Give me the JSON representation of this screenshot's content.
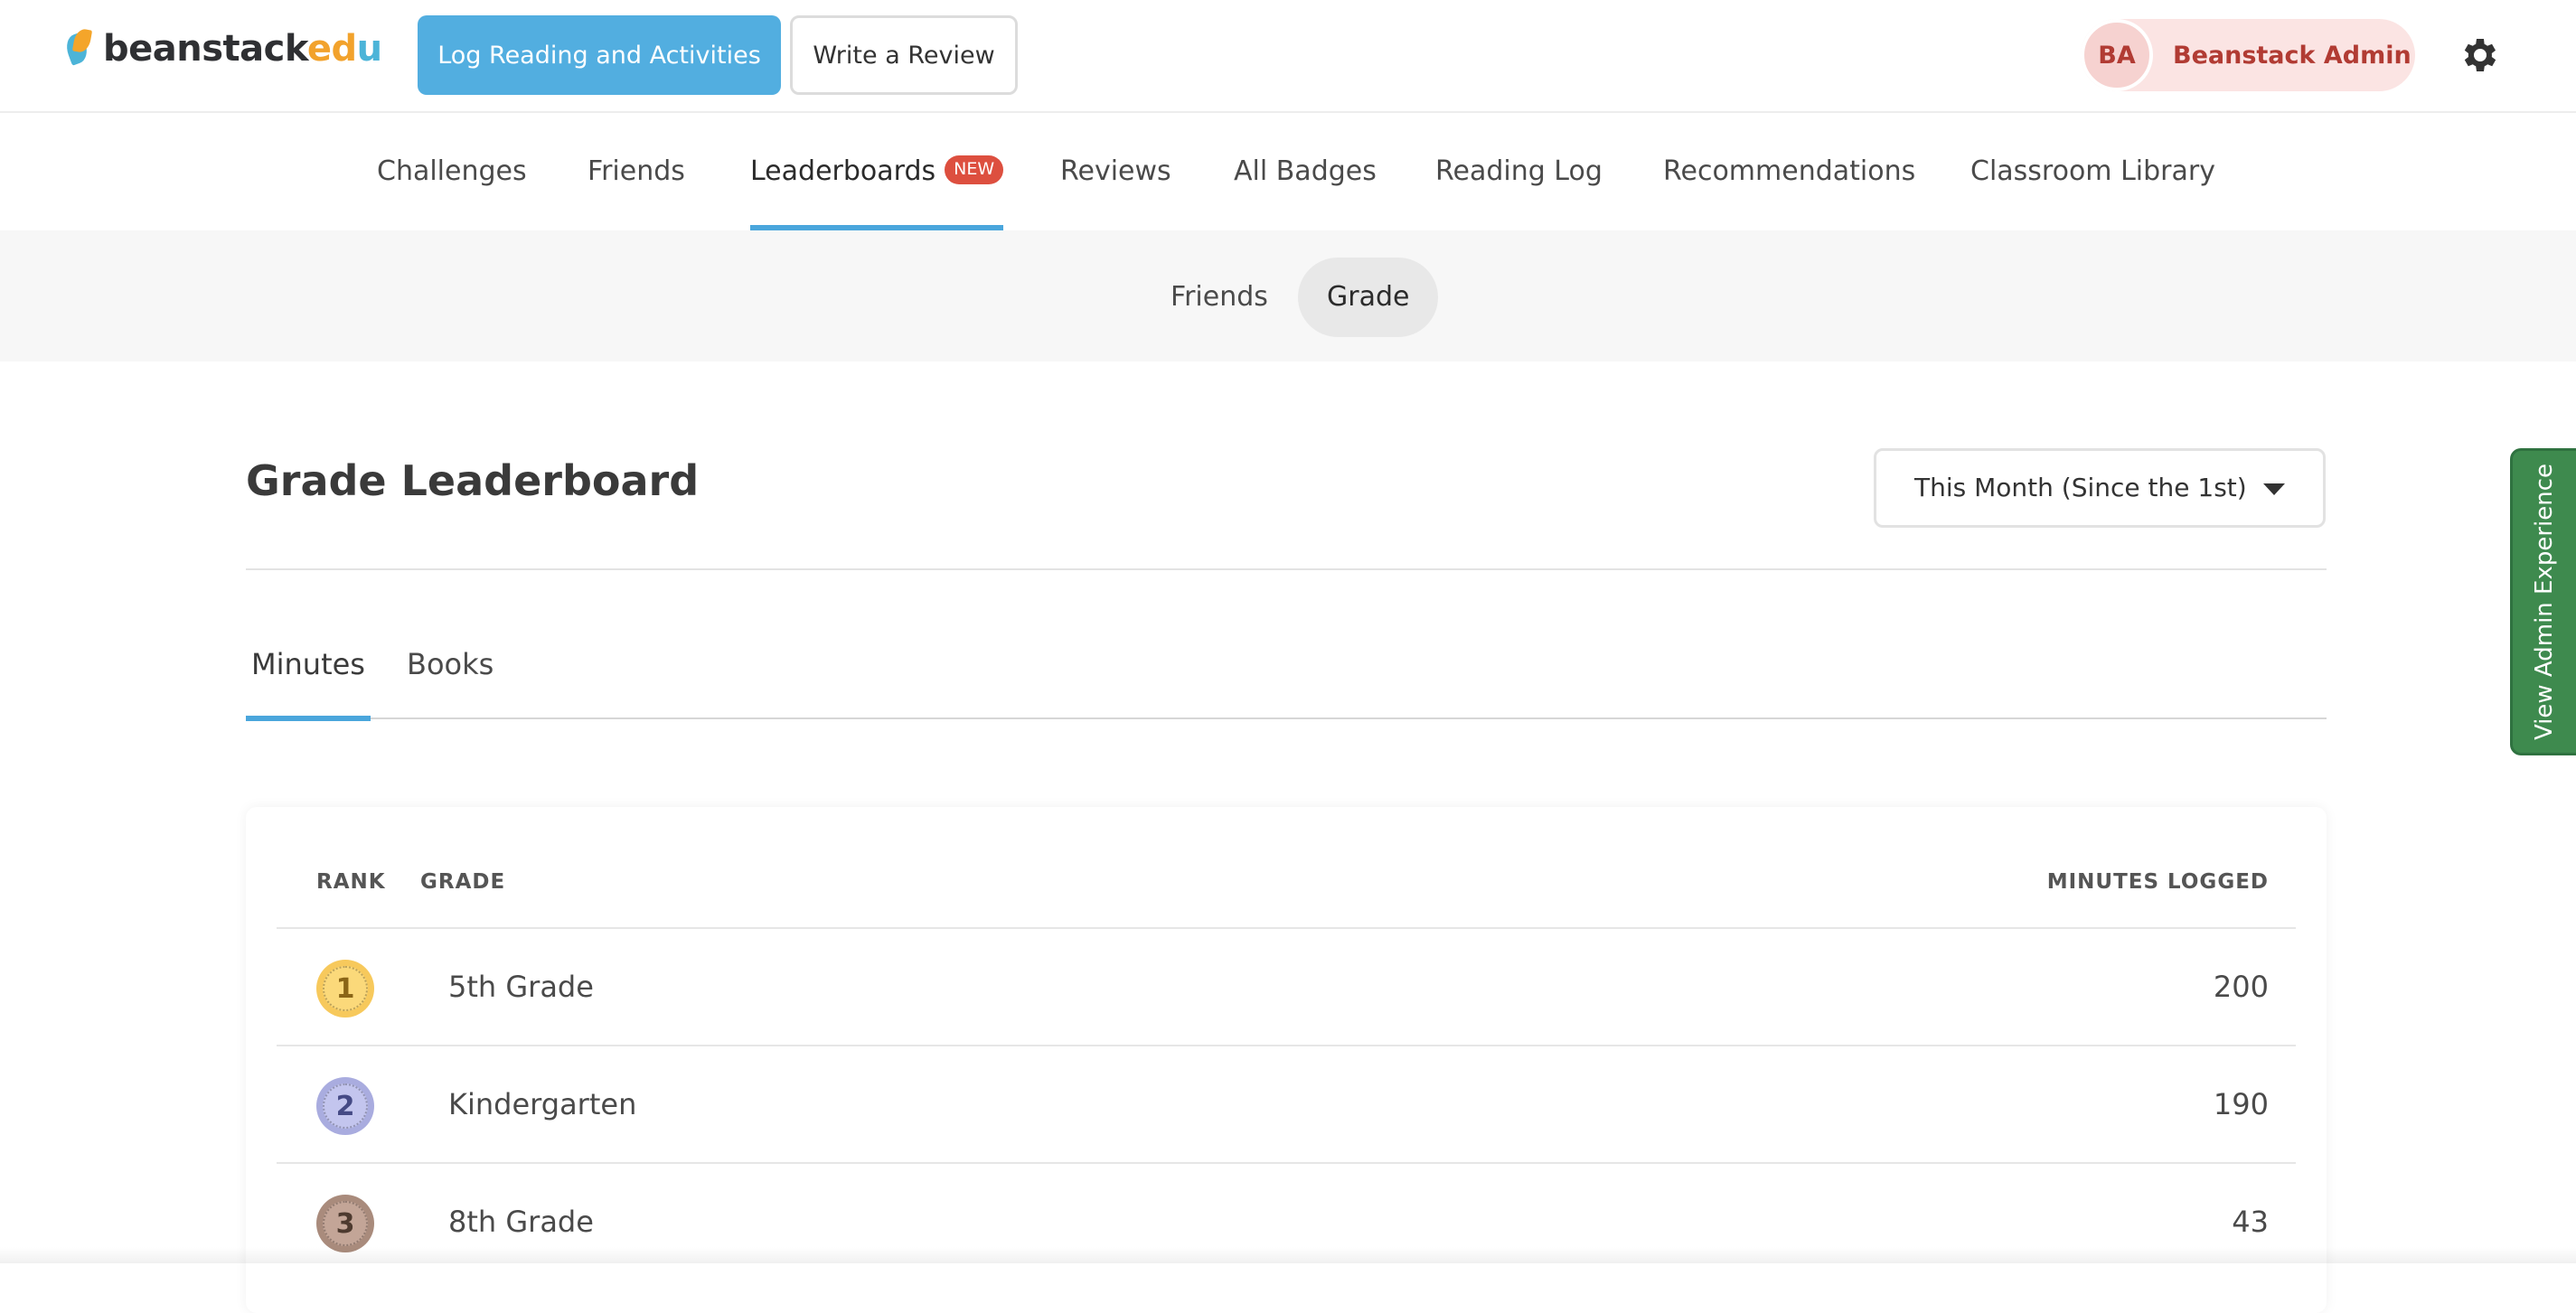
{
  "header": {
    "logo": {
      "text_main": "beanstack",
      "text_edu_1": "ed",
      "text_edu_2": "u"
    },
    "log_button": "Log Reading and Activities",
    "review_button": "Write a Review",
    "user": {
      "initials": "BA",
      "name": "Beanstack Admin"
    }
  },
  "nav": {
    "items": [
      {
        "label": "Challenges"
      },
      {
        "label": "Friends"
      },
      {
        "label": "Leaderboards",
        "badge": "NEW",
        "active": true
      },
      {
        "label": "Reviews"
      },
      {
        "label": "All Badges"
      },
      {
        "label": "Reading Log"
      },
      {
        "label": "Recommendations"
      },
      {
        "label": "Classroom Library"
      }
    ]
  },
  "subnav": {
    "items": [
      {
        "label": "Friends"
      },
      {
        "label": "Grade",
        "active": true
      }
    ]
  },
  "leaderboard": {
    "title": "Grade Leaderboard",
    "range": "This Month (Since the 1st)",
    "tabs": [
      {
        "label": "Minutes",
        "active": true
      },
      {
        "label": "Books"
      }
    ],
    "columns": {
      "rank": "RANK",
      "grade": "GRADE",
      "minutes": "MINUTES LOGGED"
    },
    "rows": [
      {
        "rank": "1",
        "grade": "5th Grade",
        "minutes": "200",
        "medal": "gold"
      },
      {
        "rank": "2",
        "grade": "Kindergarten",
        "minutes": "190",
        "medal": "silver"
      },
      {
        "rank": "3",
        "grade": "8th Grade",
        "minutes": "43",
        "medal": "bronze"
      }
    ]
  },
  "side_tab": {
    "label": "View Admin Experience"
  },
  "colors": {
    "primary_blue": "#52aee0",
    "accent_red": "#dd4f3f",
    "admin_green": "#3e8a4e",
    "user_pill": "#fbe4e3"
  },
  "icons": {
    "settings": "gear-icon",
    "dropdown": "caret-down-icon",
    "logo": "beanstack-leaf-icon"
  }
}
